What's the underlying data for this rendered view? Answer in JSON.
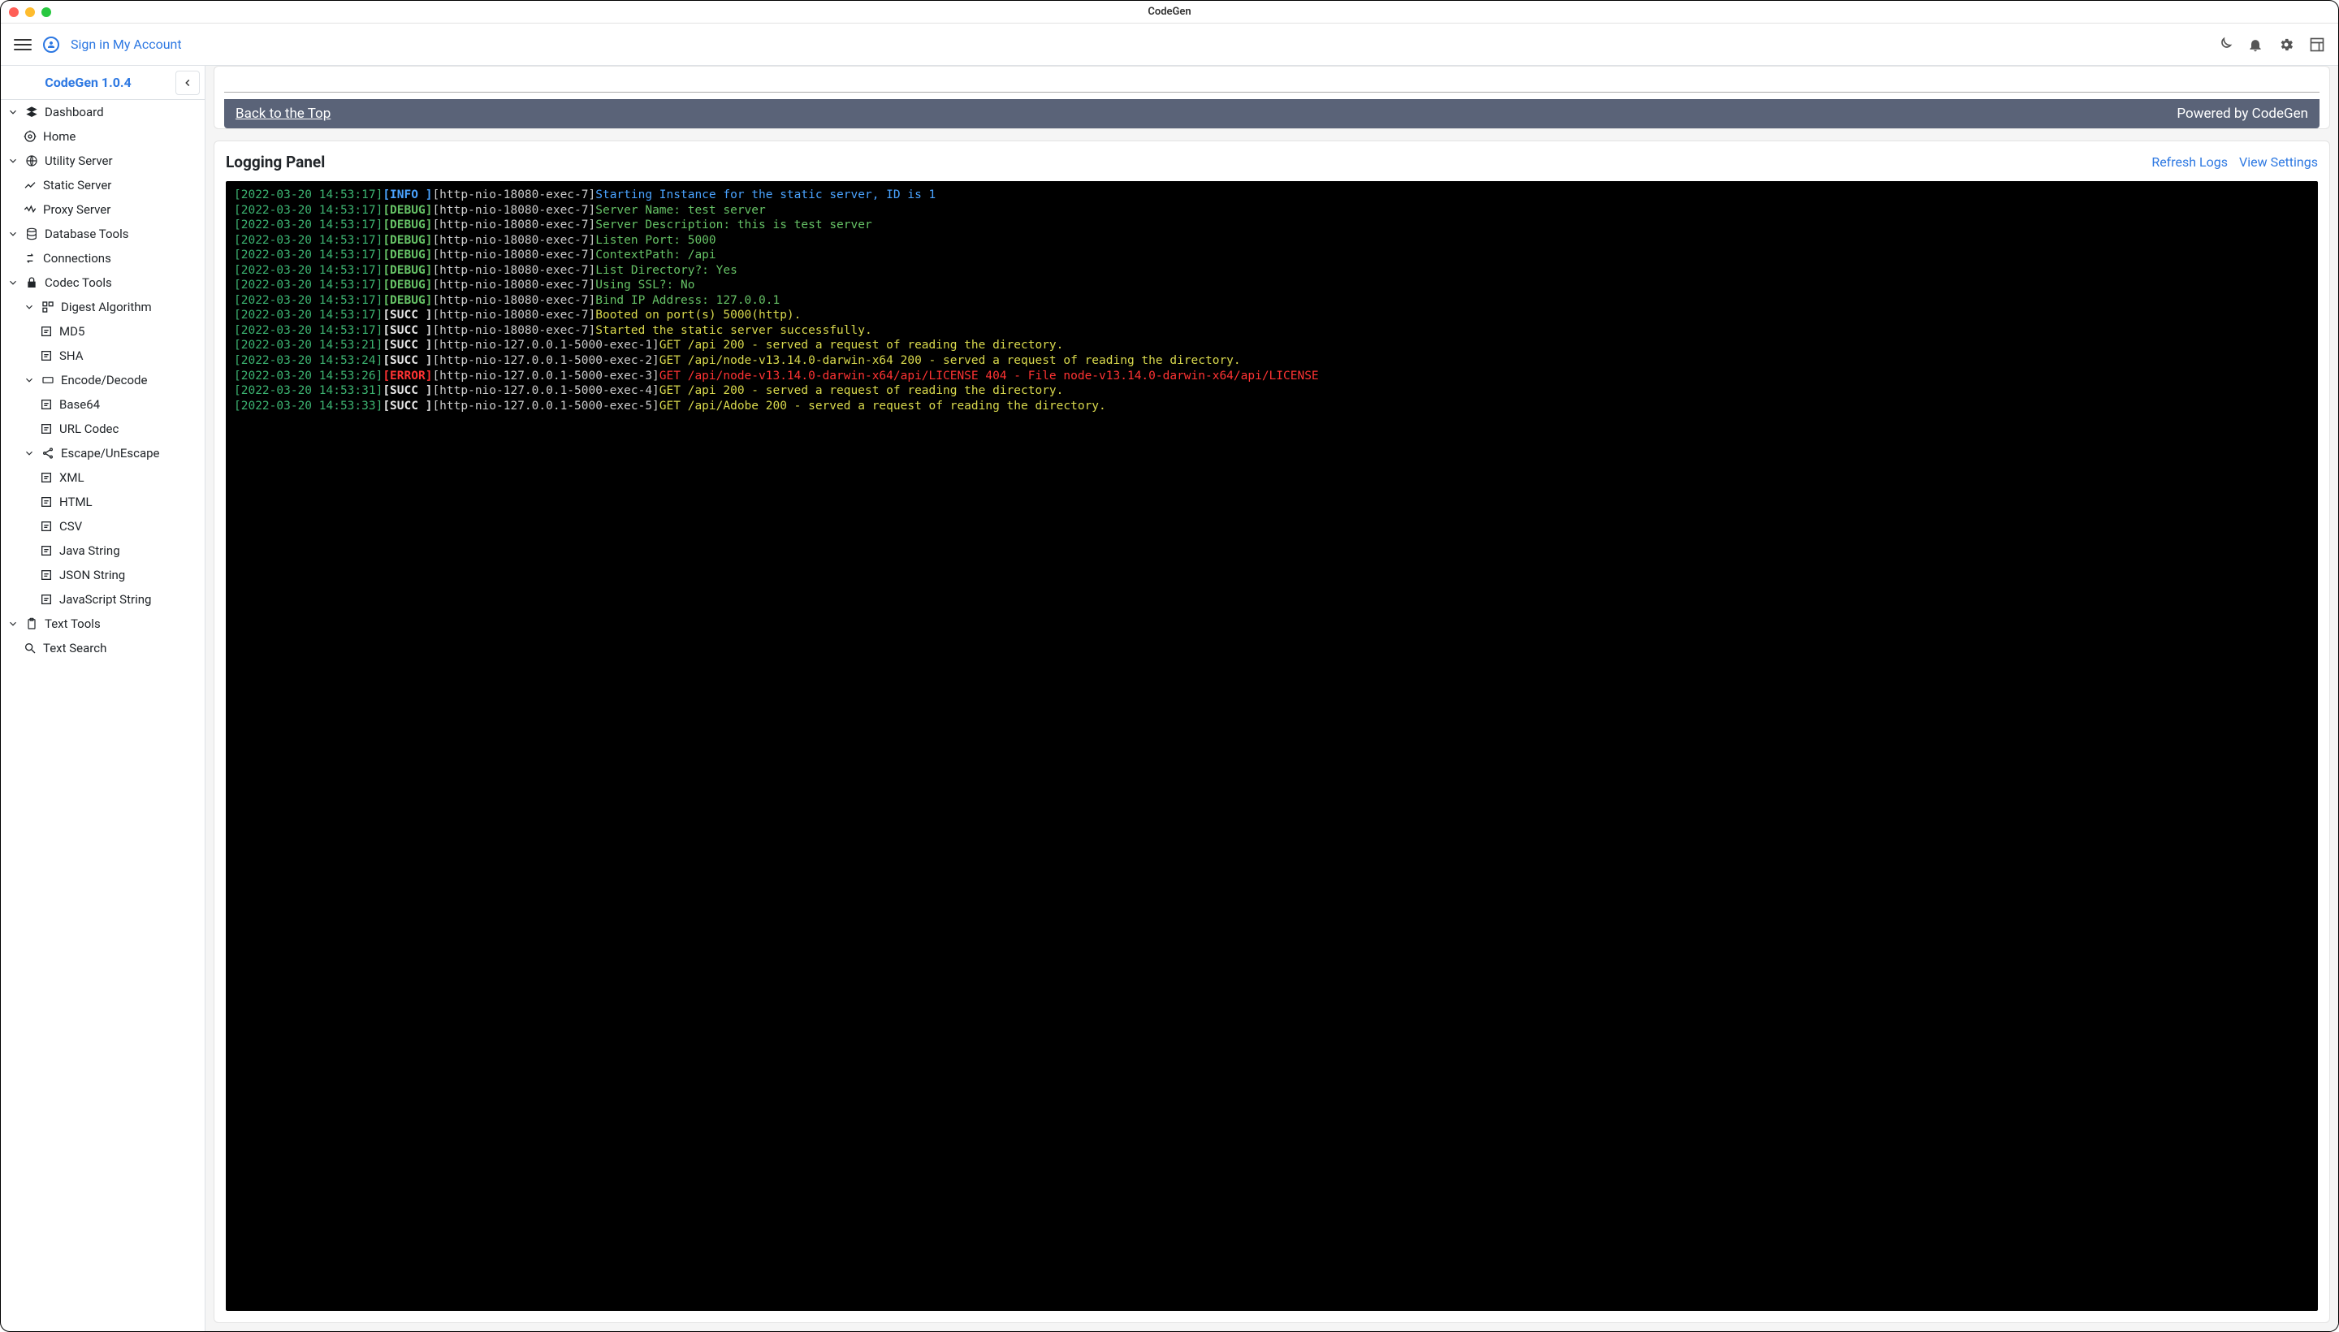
{
  "window": {
    "title": "CodeGen"
  },
  "topbar": {
    "signin": "Sign in My Account"
  },
  "sidebar": {
    "app_name": "CodeGen 1.0.4",
    "dashboard": "Dashboard",
    "home": "Home",
    "utility_server": "Utility Server",
    "static_server": "Static Server",
    "proxy_server": "Proxy Server",
    "database_tools": "Database Tools",
    "connections": "Connections",
    "codec_tools": "Codec Tools",
    "digest_algorithm": "Digest Algorithm",
    "md5": "MD5",
    "sha": "SHA",
    "encode_decode": "Encode/Decode",
    "base64": "Base64",
    "url_codec": "URL Codec",
    "escape_unescape": "Escape/UnEscape",
    "xml": "XML",
    "html": "HTML",
    "csv": "CSV",
    "java_string": "Java String",
    "json_string": "JSON String",
    "javascript_string": "JavaScript String",
    "text_tools": "Text Tools",
    "text_search": "Text Search"
  },
  "statusbar": {
    "back": "Back to the Top",
    "powered": "Powered by CodeGen"
  },
  "logpanel": {
    "title": "Logging Panel",
    "refresh": "Refresh Logs",
    "view_settings": "View Settings",
    "logs": [
      {
        "ts": "[2022-03-20 14:53:17]",
        "lvl": "INFO ",
        "lvlClass": "lvl-info",
        "thread": "[http-nio-18080-exec-7]",
        "msg": "Starting Instance for the static server, ID is 1",
        "msgClass": "msg-info"
      },
      {
        "ts": "[2022-03-20 14:53:17]",
        "lvl": "DEBUG",
        "lvlClass": "lvl-debug",
        "thread": "[http-nio-18080-exec-7]",
        "msg": "Server Name: test server",
        "msgClass": "msg-debug"
      },
      {
        "ts": "[2022-03-20 14:53:17]",
        "lvl": "DEBUG",
        "lvlClass": "lvl-debug",
        "thread": "[http-nio-18080-exec-7]",
        "msg": "Server Description: this is test server",
        "msgClass": "msg-debug"
      },
      {
        "ts": "[2022-03-20 14:53:17]",
        "lvl": "DEBUG",
        "lvlClass": "lvl-debug",
        "thread": "[http-nio-18080-exec-7]",
        "msg": "Listen Port: 5000",
        "msgClass": "msg-debug"
      },
      {
        "ts": "[2022-03-20 14:53:17]",
        "lvl": "DEBUG",
        "lvlClass": "lvl-debug",
        "thread": "[http-nio-18080-exec-7]",
        "msg": "ContextPath: /api",
        "msgClass": "msg-debug"
      },
      {
        "ts": "[2022-03-20 14:53:17]",
        "lvl": "DEBUG",
        "lvlClass": "lvl-debug",
        "thread": "[http-nio-18080-exec-7]",
        "msg": "List Directory?: Yes",
        "msgClass": "msg-debug"
      },
      {
        "ts": "[2022-03-20 14:53:17]",
        "lvl": "DEBUG",
        "lvlClass": "lvl-debug",
        "thread": "[http-nio-18080-exec-7]",
        "msg": "Using SSL?: No",
        "msgClass": "msg-debug"
      },
      {
        "ts": "[2022-03-20 14:53:17]",
        "lvl": "DEBUG",
        "lvlClass": "lvl-debug",
        "thread": "[http-nio-18080-exec-7]",
        "msg": "Bind IP Address: 127.0.0.1",
        "msgClass": "msg-debug"
      },
      {
        "ts": "[2022-03-20 14:53:17]",
        "lvl": "SUCC ",
        "lvlClass": "lvl-succ",
        "thread": "[http-nio-18080-exec-7]",
        "msg": "Booted on port(s) 5000(http).",
        "msgClass": "msg-succ"
      },
      {
        "ts": "[2022-03-20 14:53:17]",
        "lvl": "SUCC ",
        "lvlClass": "lvl-succ",
        "thread": "[http-nio-18080-exec-7]",
        "msg": "Started the static server successfully.",
        "msgClass": "msg-succ"
      },
      {
        "ts": "[2022-03-20 14:53:21]",
        "lvl": "SUCC ",
        "lvlClass": "lvl-succ",
        "thread": "[http-nio-127.0.0.1-5000-exec-1]",
        "msg": "GET /api 200 - served a request of reading the directory.",
        "msgClass": "msg-succ"
      },
      {
        "ts": "[2022-03-20 14:53:24]",
        "lvl": "SUCC ",
        "lvlClass": "lvl-succ",
        "thread": "[http-nio-127.0.0.1-5000-exec-2]",
        "msg": "GET /api/node-v13.14.0-darwin-x64 200 - served a request of reading the directory.",
        "msgClass": "msg-succ"
      },
      {
        "ts": "[2022-03-20 14:53:26]",
        "lvl": "ERROR",
        "lvlClass": "lvl-error",
        "thread": "[http-nio-127.0.0.1-5000-exec-3]",
        "msg": "GET /api/node-v13.14.0-darwin-x64/api/LICENSE 404 - File node-v13.14.0-darwin-x64/api/LICENSE",
        "msgClass": "msg-error"
      },
      {
        "ts": "[2022-03-20 14:53:31]",
        "lvl": "SUCC ",
        "lvlClass": "lvl-succ",
        "thread": "[http-nio-127.0.0.1-5000-exec-4]",
        "msg": "GET /api 200 - served a request of reading the directory.",
        "msgClass": "msg-succ"
      },
      {
        "ts": "[2022-03-20 14:53:33]",
        "lvl": "SUCC ",
        "lvlClass": "lvl-succ",
        "thread": "[http-nio-127.0.0.1-5000-exec-5]",
        "msg": "GET /api/Adobe 200 - served a request of reading the directory.",
        "msgClass": "msg-succ"
      }
    ]
  }
}
